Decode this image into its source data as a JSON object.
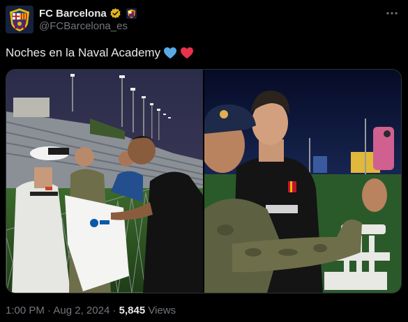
{
  "account": {
    "display_name": "FC Barcelona",
    "handle": "@FCBarcelona_es",
    "brand_colors": {
      "blue": "#004d98",
      "garnet": "#a50044",
      "gold": "#edbb00"
    }
  },
  "icons": {
    "verified": "verified-badge-icon",
    "affiliation": "club-crest-icon",
    "more": "more-options-icon",
    "hearts": [
      "blue-heart-icon",
      "red-heart-icon"
    ]
  },
  "tweet": {
    "text": "Noches en la Naval Academy",
    "heart_colors": [
      "#5aa9e6",
      "#e8324a"
    ]
  },
  "meta": {
    "time": "1:00 PM",
    "sep1": " · ",
    "date": "Aug 2, 2024",
    "sep2": " · ",
    "views_count": "5,845",
    "views_label": " Views"
  }
}
